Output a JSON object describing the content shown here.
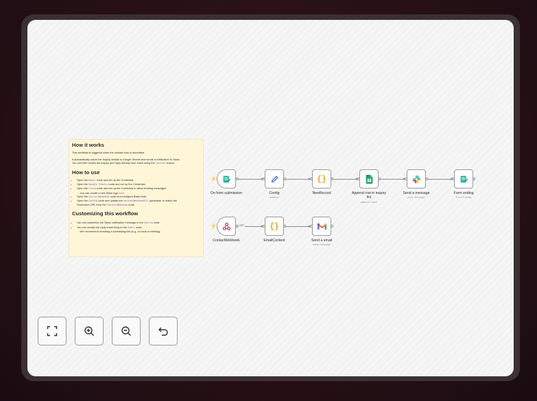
{
  "note": {
    "heading1": "How it works",
    "p1": "This workflow is triggered when the contact form is submitted.",
    "p2a": "It automatically saves the inquiry details to Google Sheets and sends a notification to Slack.",
    "p2b": "You can then review the inquiry and reply directly from Slack using the",
    "p2code": "Contact",
    "p2c": "button.",
    "heading2": "How to use",
    "use1a": "Open the",
    "use1code": "Email",
    "use1b": "node and set up the Credential.",
    "use2a": "Open the",
    "use2code": "Google Sheets",
    "use2b": "node and set up the Credential.",
    "use3a": "Open the",
    "use3code": "Slack",
    "use3b": "node and set up the Credential to allow sending messages.",
    "use3sub": "You can create a new Slack App",
    "use3link": "here",
    "use4a": "Open the",
    "use4code": "ContactWebhook",
    "use4b": "node and configure Basic Auth.",
    "use5a": "Open the",
    "use5code": "Config",
    "use5b": "node and update the",
    "use5code2": "contactWebhookUrl",
    "use5c": "parameter to match the",
    "use5d": "Production URL from the",
    "use5code3": "ContactWebhook",
    "use5e": "node.",
    "heading3": "Customizing this workflow",
    "cust1a": "You can customize the Slack notification message in the",
    "cust1code": "Config",
    "cust1b": "node.",
    "cust2a": "You can modify the reply email body in the",
    "cust2code": "Email",
    "cust2b": "node.",
    "cust2sub": "We recommend including a scheduling link (e.g., to book a meeting)."
  },
  "nodes": {
    "form_submission": {
      "label": "On form submission",
      "icon": "form-icon"
    },
    "config": {
      "label": "Config",
      "sub": "manual",
      "icon": "pencil-icon"
    },
    "new_record": {
      "label": "NewRecord",
      "icon": "braces-icon"
    },
    "append_row": {
      "label": "Append row in inquiry list",
      "sub": "append: sheet",
      "icon": "google-sheets-icon"
    },
    "send_message": {
      "label": "Send a message",
      "sub": "post: message",
      "icon": "slack-icon"
    },
    "form_ending": {
      "label": "Form ending",
      "sub": "Form Ending",
      "icon": "form-icon"
    },
    "contact_webhook": {
      "label": "ContactWebhook",
      "icon": "webhook-icon"
    },
    "email_content": {
      "label": "EmailContent",
      "icon": "braces-icon"
    },
    "send_email": {
      "label": "Send a email",
      "sub": "send: message",
      "icon": "gmail-icon"
    }
  },
  "edges": {
    "webhook_method": "GET"
  },
  "controls": {
    "fit": {
      "icon": "fit-view-icon"
    },
    "zoom_in": {
      "icon": "zoom-in-icon"
    },
    "zoom_out": {
      "icon": "zoom-out-icon"
    },
    "undo": {
      "icon": "undo-icon"
    }
  },
  "colors": {
    "trigger_bolt": "#e04a5a",
    "note_bg": "#fff6d8",
    "code": "#7c4dbd",
    "gmail_red": "#ea4335",
    "sheets_green": "#1ea362",
    "form_teal": "#2bb3a3"
  }
}
